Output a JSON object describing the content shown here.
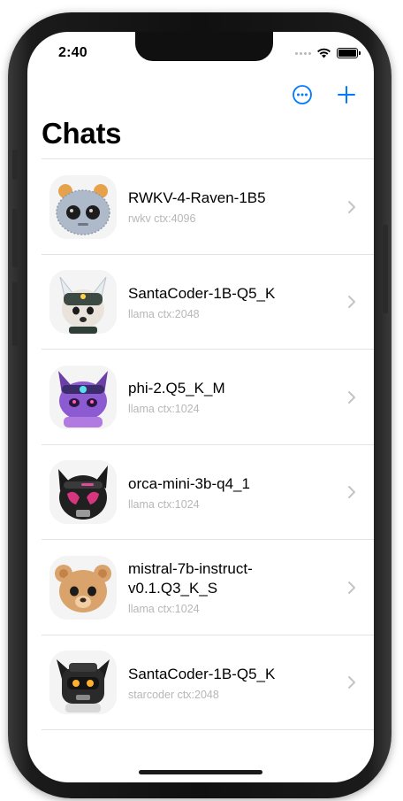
{
  "status_bar": {
    "time": "2:40"
  },
  "nav": {
    "more_icon": "ellipsis-circle-icon",
    "add_icon": "plus-icon",
    "accent_color": "#007AFF"
  },
  "title": "Chats",
  "chats": [
    {
      "title": "RWKV-4-Raven-1B5",
      "subtitle": "rwkv ctx:4096",
      "avatar": "knit-robot-avatar"
    },
    {
      "title": "SantaCoder-1B-Q5_K",
      "subtitle": "llama ctx:2048",
      "avatar": "fox-avatar"
    },
    {
      "title": "phi-2.Q5_K_M",
      "subtitle": "llama ctx:1024",
      "avatar": "purple-cat-avatar"
    },
    {
      "title": "orca-mini-3b-q4_1",
      "subtitle": "llama ctx:1024",
      "avatar": "black-cat-helmet-avatar"
    },
    {
      "title": "mistral-7b-instruct-v0.1.Q3_K_S",
      "subtitle": "llama ctx:1024",
      "avatar": "bear-avatar"
    },
    {
      "title": "SantaCoder-1B-Q5_K",
      "subtitle": "starcoder ctx:2048",
      "avatar": "robot-avatar"
    }
  ]
}
